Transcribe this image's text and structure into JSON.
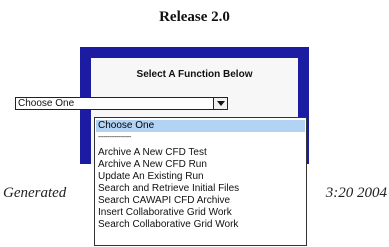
{
  "header": {
    "title": "Release 2.0"
  },
  "panel": {
    "heading": "Select A Function Below"
  },
  "select": {
    "current_value": "Choose One"
  },
  "dropdown": {
    "options": [
      "Choose One",
      "------------------",
      "Archive A New CFD Test",
      "Archive A New CFD Run",
      "Update An Existing Run",
      "Search and Retrieve Initial Files",
      "Search CAWAPI CFD Archive",
      "Insert Collaborative Grid Work",
      "Search Collaborative Grid Work"
    ]
  },
  "footer": {
    "left_fragment": "Generated",
    "right_fragment": "3:20 2004"
  },
  "colors": {
    "panel_border": "#1c1ca3",
    "highlight": "#b3d3f5"
  }
}
